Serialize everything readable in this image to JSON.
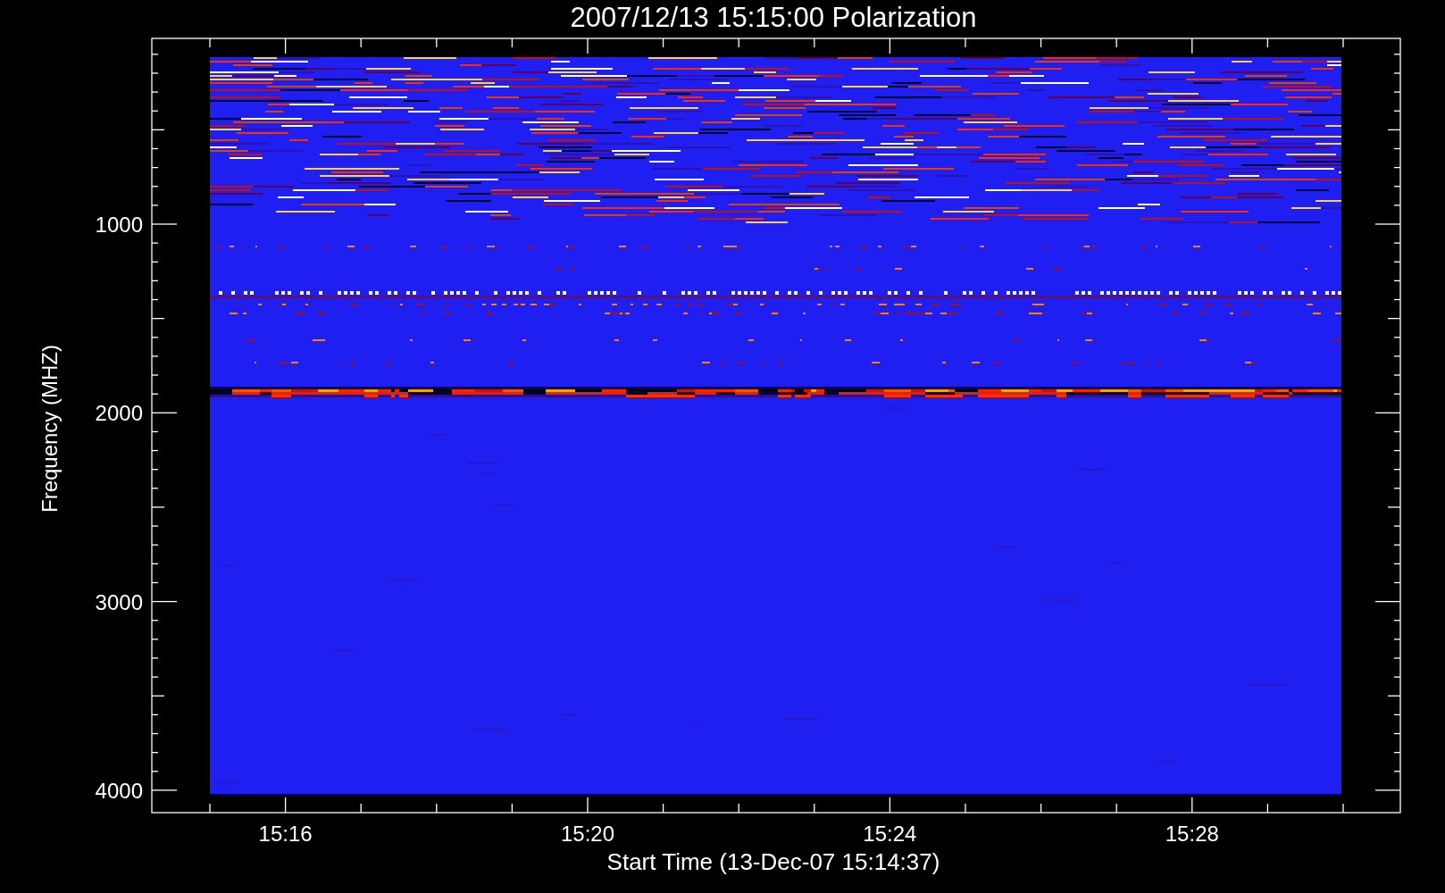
{
  "plot": {
    "title": "2007/12/13 15:15:00 Polarization",
    "xlabel": "Start Time (13-Dec-07 15:14:37)",
    "ylabel": "Frequency (MHZ)",
    "xtick_labels": [
      "15:16",
      "15:20",
      "15:24",
      "15:28"
    ],
    "ytick_labels": [
      "1000",
      "2000",
      "3000",
      "4000"
    ]
  }
}
